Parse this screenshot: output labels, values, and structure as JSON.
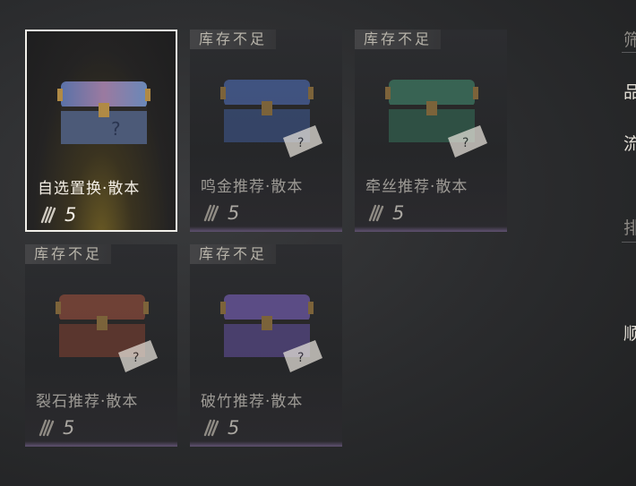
{
  "items": [
    {
      "name": "自选置换·散本",
      "cost": "5",
      "status": "",
      "selected": true,
      "tint": "#6a6fa8"
    },
    {
      "name": "鸣金推荐·散本",
      "cost": "5",
      "status": "库存不足",
      "selected": false,
      "tint": "#4a63a0"
    },
    {
      "name": "牵丝推荐·散本",
      "cost": "5",
      "status": "库存不足",
      "selected": false,
      "tint": "#3e7a62"
    },
    {
      "name": "裂石推荐·散本",
      "cost": "5",
      "status": "库存不足",
      "selected": false,
      "tint": "#8a4a3a"
    },
    {
      "name": "破竹推荐·散本",
      "cost": "5",
      "status": "库存不足",
      "selected": false,
      "tint": "#6f5aa8"
    }
  ],
  "currency_icon": "feather-icon",
  "side_panel": {
    "labels": [
      "筛",
      "品",
      "流",
      "排",
      "顺"
    ]
  }
}
